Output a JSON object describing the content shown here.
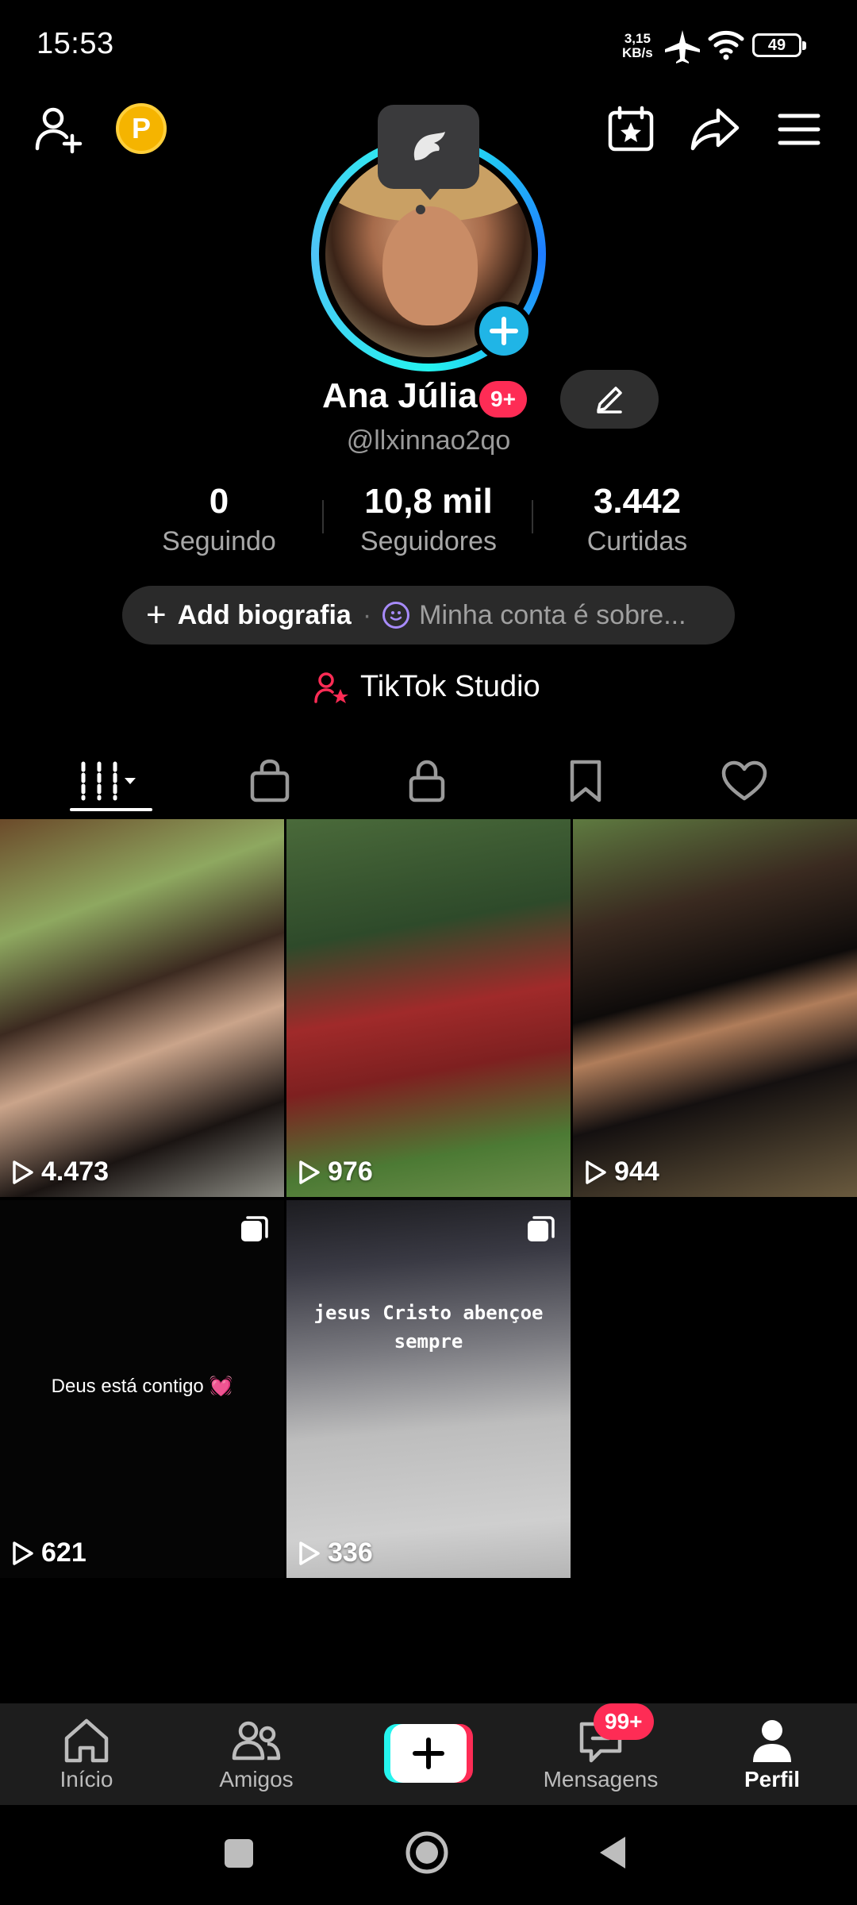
{
  "status_bar": {
    "time": "15:53",
    "net_speed_value": "3,15",
    "net_speed_unit": "KB/s",
    "battery": "49"
  },
  "profile": {
    "name": "Ana Júlia",
    "name_badge": "9+",
    "handle": "@llxinnao2qo",
    "coin_label": "P"
  },
  "stats": [
    {
      "value": "0",
      "label": "Seguindo"
    },
    {
      "value": "10,8 mil",
      "label": "Seguidores"
    },
    {
      "value": "3.442",
      "label": "Curtidas"
    }
  ],
  "bio": {
    "add_label": "Add biografia",
    "separator": "·",
    "placeholder": "Minha conta é sobre..."
  },
  "studio_label": "TikTok Studio",
  "videos": [
    {
      "views": "4.473"
    },
    {
      "views": "976"
    },
    {
      "views": "944"
    },
    {
      "views": "621",
      "caption": "Deus está contigo 💓"
    },
    {
      "views": "336",
      "caption": "jesus Cristo abençoe sempre"
    }
  ],
  "bottom_nav": {
    "home": "Início",
    "friends": "Amigos",
    "messages": "Mensagens",
    "messages_badge": "99+",
    "profile": "Perfil"
  },
  "colors": {
    "accent": "#fe2c55",
    "ring": "#25f4ee",
    "coin": "#f5b400"
  }
}
